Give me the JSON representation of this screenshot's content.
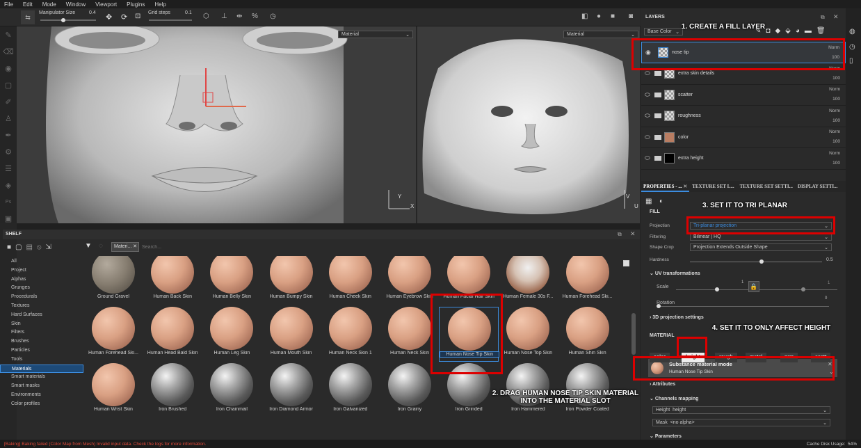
{
  "menu": [
    "File",
    "Edit",
    "Mode",
    "Window",
    "Viewport",
    "Plugins",
    "Help"
  ],
  "toolbar": {
    "manip_label": "Manipulator Size",
    "manip_value": "0.4",
    "grid_label": "Grid steps",
    "grid_value": "0.1"
  },
  "viewport": {
    "left_mode": "Material",
    "right_mode": "Material",
    "axis_x": "X",
    "axis_y": "Y",
    "axis_u": "U",
    "axis_v": "V"
  },
  "layers": {
    "title": "LAYERS",
    "channel": "Base Color",
    "items": [
      {
        "name": "nose tip",
        "blend": "Norm",
        "opacity": "100"
      },
      {
        "name": "extra skin details",
        "blend": "Norm",
        "opacity": "100"
      },
      {
        "name": "scatter",
        "blend": "Norm",
        "opacity": "100"
      },
      {
        "name": "roughness",
        "blend": "Norm",
        "opacity": "100"
      },
      {
        "name": "color",
        "blend": "Norm",
        "opacity": "100"
      },
      {
        "name": "extra height",
        "blend": "Norm",
        "opacity": "100"
      }
    ]
  },
  "tabs": [
    "PROPERTIES - ...",
    "TEXTURE SET L...",
    "TEXTURE SET SETTI...",
    "DISPLAY SETTI..."
  ],
  "fill": {
    "title": "FILL",
    "projection_label": "Projection",
    "projection_value": "Tri-planar projection",
    "filtering_label": "Filtering",
    "filtering_value": "Bilinear | HQ",
    "shapecrop_label": "Shape Crop",
    "shapecrop_value": "Projection Extends Outside Shape",
    "hardness_label": "Hardness",
    "hardness_value": "0.5",
    "uv_title": "UV transformations",
    "scale_label": "Scale",
    "scale_value": "1",
    "scale_right": "1",
    "rotation_label": "Rotation",
    "rotation_value": "0",
    "proj3d_title": "3D projection settings"
  },
  "material": {
    "title": "MATERIAL",
    "channels": [
      "color",
      "height",
      "rough",
      "metal",
      "nrm",
      "scatt"
    ],
    "mode_title": "Substance material mode",
    "mode_value": "Human Nose Tip Skin",
    "attributes": "Attributes",
    "mapping_title": "Channels mapping",
    "height_label": "Height",
    "height_value": "height",
    "mask_label": "Mask",
    "mask_value": "<no alpha>",
    "params_title": "Parameters"
  },
  "shelf": {
    "title": "SHELF",
    "filter_chip": "Materi...",
    "search_placeholder": "Search...",
    "categories": [
      "All",
      "Project",
      "Alphas",
      "Grunges",
      "Procedurals",
      "Textures",
      "Hard Surfaces",
      "Skin",
      "Filters",
      "Brushes",
      "Particles",
      "Tools",
      "Materials",
      "Smart materials",
      "Smart masks",
      "Environments",
      "Color profiles"
    ],
    "selected_category": "Materials",
    "items": [
      {
        "label": "Ground Gravel",
        "kind": "gravel"
      },
      {
        "label": "Human Back Skin",
        "kind": "skin"
      },
      {
        "label": "Human Belly Skin",
        "kind": "skin"
      },
      {
        "label": "Human Bumpy Skin",
        "kind": "skin"
      },
      {
        "label": "Human Cheek Skin",
        "kind": "skin"
      },
      {
        "label": "Human Eyebrow Skin",
        "kind": "skin"
      },
      {
        "label": "Human Facial Hair Skin",
        "kind": "skin"
      },
      {
        "label": "Human Female 30s F...",
        "kind": "face"
      },
      {
        "label": "Human Forehead Ski...",
        "kind": "skin"
      },
      {
        "label": "Human Forehead Ski...",
        "kind": "skin"
      },
      {
        "label": "Human Head Bald Skin",
        "kind": "skin"
      },
      {
        "label": "Human Leg Skin",
        "kind": "skin"
      },
      {
        "label": "Human Mouth Skin",
        "kind": "skin"
      },
      {
        "label": "Human Neck Skin 1",
        "kind": "skin"
      },
      {
        "label": "Human Neck Skin",
        "kind": "skin"
      },
      {
        "label": "Human Nose Tip Skin",
        "kind": "skin"
      },
      {
        "label": "Human Nose Top Skin",
        "kind": "skin"
      },
      {
        "label": "Human Shin Skin",
        "kind": "skin"
      },
      {
        "label": "Human Wrist Skin",
        "kind": "skin"
      },
      {
        "label": "Iron Brushed",
        "kind": "iron"
      },
      {
        "label": "Iron Chainmail",
        "kind": "iron"
      },
      {
        "label": "Iron Diamond Armor",
        "kind": "iron"
      },
      {
        "label": "Iron Galvanized",
        "kind": "iron"
      },
      {
        "label": "Iron Grainy",
        "kind": "iron"
      },
      {
        "label": "Iron Grinded",
        "kind": "iron"
      },
      {
        "label": "Iron Hammered",
        "kind": "iron"
      },
      {
        "label": "Iron Powder Coated",
        "kind": "iron"
      }
    ]
  },
  "annotations": {
    "a1": "1. CREATE A FILL LAYER",
    "a2": "2. DRAG HUMAN NOSE TIP SKIN MATERIAL INTO THE MATERIAL SLOT",
    "a3": "3. SET IT TO TRI PLANAR",
    "a4": "4. SET IT TO ONLY AFFECT HEIGHT"
  },
  "status": {
    "message": "[Baking] Baking failed (Color Map from Mesh) Invalid input data. Check the logs for more information.",
    "cache_label": "Cache Disk Usage:",
    "cache_value": "54%"
  },
  "colors": {
    "accent": "#3c8de0",
    "annotation_red": "#dd0000",
    "error_text": "#e04a3a"
  }
}
